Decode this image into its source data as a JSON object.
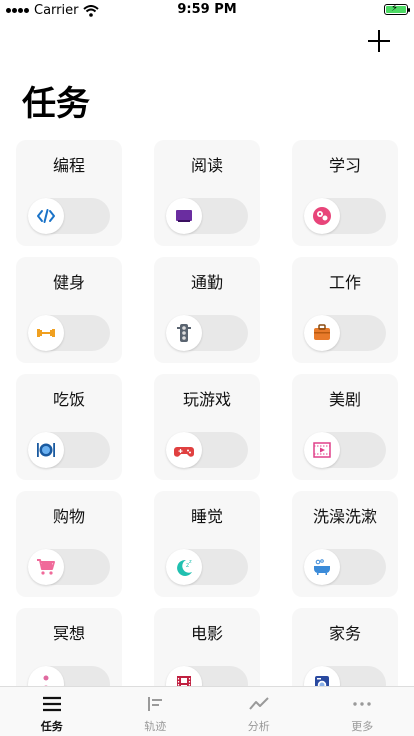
{
  "status_bar": {
    "carrier": "Carrier",
    "time": "9:59 PM"
  },
  "page_title": "任务",
  "tasks": [
    {
      "label": "编程",
      "icon": "code-icon",
      "color": "#1a73c8"
    },
    {
      "label": "阅读",
      "icon": "book-icon",
      "color": "#6a2da0"
    },
    {
      "label": "学习",
      "icon": "brain-gears-icon",
      "color": "#e8457a"
    },
    {
      "label": "健身",
      "icon": "dumbbell-icon",
      "color": "#f0a020"
    },
    {
      "label": "通勤",
      "icon": "traffic-light-icon",
      "color": "#5a6470"
    },
    {
      "label": "工作",
      "icon": "briefcase-icon",
      "color": "#e87a2a"
    },
    {
      "label": "吃饭",
      "icon": "plate-cutlery-icon",
      "color": "#1a5aa0"
    },
    {
      "label": "玩游戏",
      "icon": "gamepad-icon",
      "color": "#e04040"
    },
    {
      "label": "美剧",
      "icon": "film-play-icon",
      "color": "#e0408a"
    },
    {
      "label": "购物",
      "icon": "shopping-cart-icon",
      "color": "#f06a9a"
    },
    {
      "label": "睡觉",
      "icon": "moon-sleep-icon",
      "color": "#20c0b0"
    },
    {
      "label": "洗澡洗漱",
      "icon": "bathtub-icon",
      "color": "#3a8ad8"
    },
    {
      "label": "冥想",
      "icon": "meditation-icon",
      "color": "#e06aa0"
    },
    {
      "label": "电影",
      "icon": "film-strip-icon",
      "color": "#c02040"
    },
    {
      "label": "家务",
      "icon": "washing-machine-icon",
      "color": "#2a4aa0"
    }
  ],
  "tabs": [
    {
      "label": "任务",
      "icon": "list-icon",
      "active": true
    },
    {
      "label": "轨迹",
      "icon": "timeline-icon",
      "active": false
    },
    {
      "label": "分析",
      "icon": "trend-chart-icon",
      "active": false
    },
    {
      "label": "更多",
      "icon": "more-dots-icon",
      "active": false
    }
  ]
}
